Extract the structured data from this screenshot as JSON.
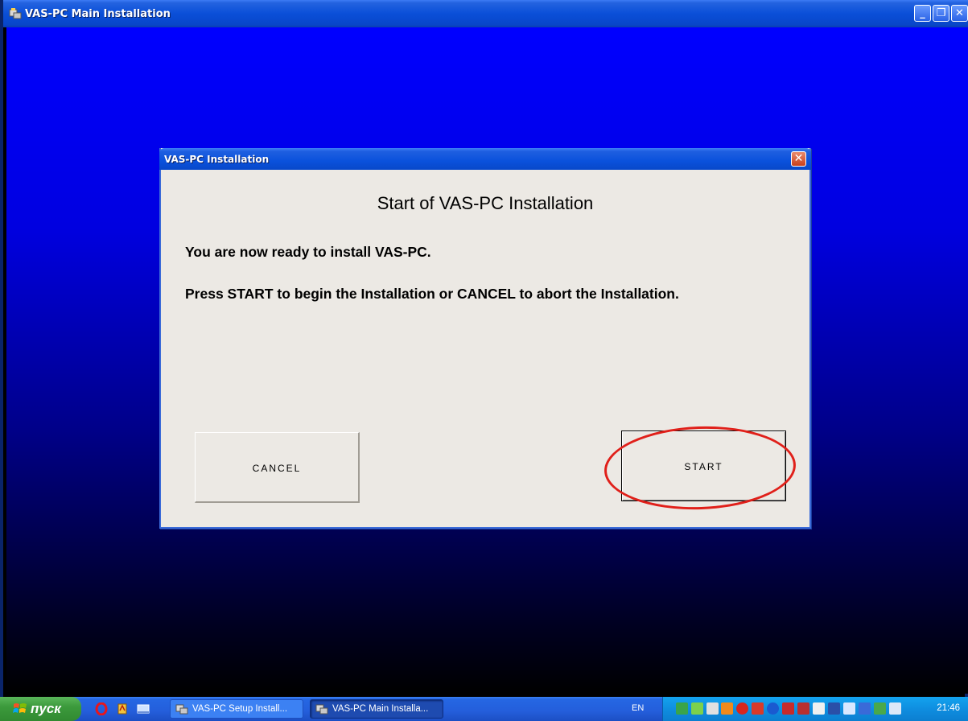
{
  "window": {
    "title": "VAS-PC  Main Installation",
    "minimize_glyph": "_",
    "restore_glyph": "❐",
    "close_glyph": "✕"
  },
  "dialog": {
    "title": "VAS-PC Installation",
    "close_glyph": "✕",
    "heading": "Start of VAS-PC Installation",
    "text1": "You are now ready to install VAS-PC.",
    "text2": "Press START to begin the Installation or CANCEL to abort the Installation.",
    "cancel_label": "CANCEL",
    "start_label": "START",
    "highlight_color": "#e0201a"
  },
  "taskbar": {
    "start_label": "пуск",
    "quick_launch": [
      "opera-icon",
      "acrobat-icon",
      "show-desktop-icon"
    ],
    "tasks": [
      {
        "label": "VAS-PC Setup Install...",
        "active": false
      },
      {
        "label": "VAS-PC Main Installa...",
        "active": true
      }
    ],
    "language": "EN",
    "clock": "21:46"
  },
  "colors": {
    "titlebar": "#0a4fd8",
    "dialog_bg": "#ece9e4",
    "start_green": "#3c9a3c",
    "tray_blue": "#0f8ee0"
  }
}
